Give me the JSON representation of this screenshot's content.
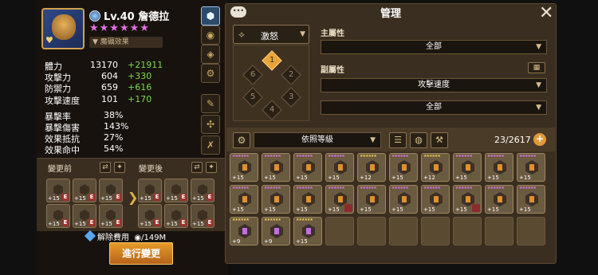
{
  "monster": {
    "level_label": "Lv.40",
    "name": "詹德拉",
    "stars": "★★★★★★",
    "rune_effect_label": "魔礪效果",
    "stats": [
      {
        "label": "體力",
        "value": "13170",
        "bonus": "+21911"
      },
      {
        "label": "攻擊力",
        "value": "604",
        "bonus": "+330"
      },
      {
        "label": "防禦力",
        "value": "659",
        "bonus": "+616"
      },
      {
        "label": "攻擊速度",
        "value": "101",
        "bonus": "+170"
      }
    ],
    "sub_stats": [
      {
        "label": "暴擊率",
        "value": "38%"
      },
      {
        "label": "暴擊傷害",
        "value": "143%"
      },
      {
        "label": "效果抵抗",
        "value": "27%"
      },
      {
        "label": "效果命中",
        "value": "54%"
      }
    ]
  },
  "change_panel": {
    "before_label": "變更前",
    "after_label": "變更後",
    "before_runes": [
      "+15",
      "+15",
      "+15",
      "+15",
      "+15",
      "+15"
    ],
    "after_runes": [
      "+15",
      "+15",
      "+15",
      "+15",
      "+15",
      "+15"
    ],
    "rune_tag": "E",
    "cost_label": "解除費用",
    "cost_value": "/149M",
    "confirm_button": "進行變更"
  },
  "manage": {
    "title": "管理",
    "chat_icon": "•••",
    "close_icon": "✕",
    "rune_set": "激怒",
    "slots": [
      "1",
      "2",
      "3",
      "4",
      "5",
      "6"
    ],
    "active_slot": "1",
    "main_attr_label": "主屬性",
    "main_attr_value": "全部",
    "sub_attr_label": "副屬性",
    "sub_attr_value_1": "攻擊速度",
    "sub_attr_value_2": "全部",
    "sort_label": "依照等級",
    "inventory_count": "23/2617",
    "plus_label": "+"
  },
  "inventory": {
    "row1": [
      "+15",
      "+15",
      "+15",
      "+15",
      "+12",
      "+15",
      "+12",
      "+15",
      "+15",
      "+15"
    ],
    "row2": [
      "+15",
      "+15",
      "+15",
      "+15",
      "+15",
      "+15",
      "+15",
      "+15",
      "+15",
      "+15"
    ],
    "row3": [
      "+9",
      "+9",
      "+15"
    ]
  },
  "colors": {
    "accent": "#e09a3a",
    "bonus_green": "#7bd94a",
    "star_pink": "#e271e2",
    "gold_star": "#f0c94a"
  }
}
